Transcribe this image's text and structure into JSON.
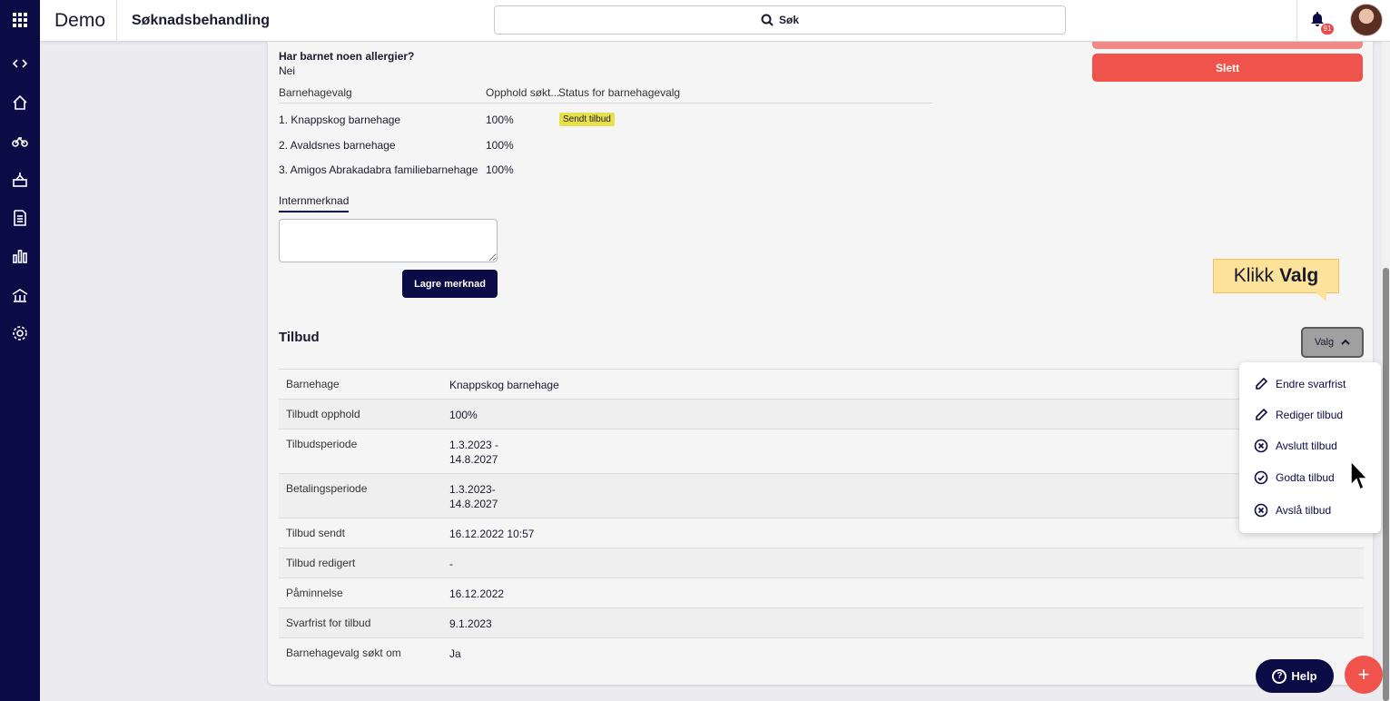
{
  "app": {
    "brand": "Demo",
    "title": "Søknadsbehandling"
  },
  "search": {
    "label": "Søk"
  },
  "notifications": {
    "count": "91"
  },
  "rail_icons": [
    "code-icon",
    "home-icon",
    "bicycle-icon",
    "building-icon",
    "document-icon",
    "chart-icon",
    "institution-icon",
    "settings-icon"
  ],
  "child": {
    "allergy_question": "Har barnet noen allergier?",
    "allergy_answer": "Nei"
  },
  "actions": {
    "delete_label": "Slett"
  },
  "kindergarten_choices": {
    "headers": [
      "Barnehagevalg",
      "Opphold søkt...",
      "Status for barnehagevalg"
    ],
    "rows": [
      {
        "name": "1. Knappskog barnehage",
        "stay": "100%",
        "status": "Sendt tilbud"
      },
      {
        "name": "2. Avaldsnes barnehage",
        "stay": "100%",
        "status": ""
      },
      {
        "name": "3. Amigos Abrakadabra familiebarnehage",
        "stay": "100%",
        "status": ""
      }
    ]
  },
  "internal_note": {
    "tab_label": "Internmerknad",
    "save_label": "Lagre merknad"
  },
  "tooltip": {
    "prefix": "Klikk",
    "emphasis": "Valg"
  },
  "offer": {
    "heading": "Tilbud",
    "valg_label": "Valg",
    "rows": [
      {
        "key": "Barnehage",
        "value": "Knappskog barnehage"
      },
      {
        "key": "Tilbudt opphold",
        "value": "100%"
      },
      {
        "key": "Tilbudsperiode",
        "value": "1.3.2023 -\n14.8.2027"
      },
      {
        "key": "Betalingsperiode",
        "value": "1.3.2023-\n14.8.2027"
      },
      {
        "key": "Tilbud sendt",
        "value": "16.12.2022 10:57"
      },
      {
        "key": "Tilbud redigert",
        "value": "-"
      },
      {
        "key": "Påminnelse",
        "value": "16.12.2022"
      },
      {
        "key": "Svarfrist for tilbud",
        "value": "9.1.2023"
      },
      {
        "key": "Barnehagevalg søkt om",
        "value": "Ja"
      }
    ]
  },
  "valg_menu": {
    "items": [
      {
        "label": "Endre svarfrist",
        "icon": "pencil-icon"
      },
      {
        "label": "Rediger tilbud",
        "icon": "pencil-icon"
      },
      {
        "label": "Avslutt tilbud",
        "icon": "circle-x-icon"
      },
      {
        "label": "Godta tilbud",
        "icon": "circle-check-icon"
      },
      {
        "label": "Avslå tilbud",
        "icon": "circle-x-icon"
      }
    ]
  },
  "help": {
    "label": "Help"
  },
  "fab": {
    "label": "+"
  },
  "colors": {
    "navy": "#0b0b45",
    "danger": "#f0524c",
    "highlight": "#e8e04a",
    "tooltip": "#fde29a"
  }
}
